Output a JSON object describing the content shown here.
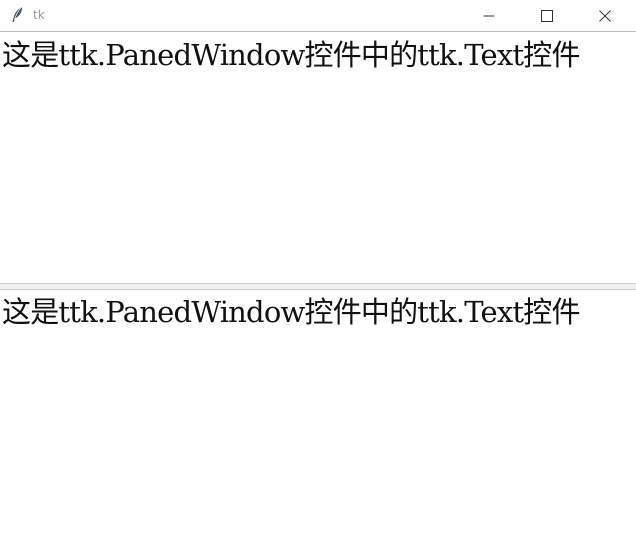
{
  "window": {
    "title": "tk",
    "icons": {
      "app": "tk-feather-icon",
      "minimize": "minimize-icon",
      "maximize": "maximize-icon",
      "close": "close-icon"
    }
  },
  "panes": [
    {
      "text": "这是ttk.PanedWindow控件中的ttk.Text控件"
    },
    {
      "text": "这是ttk.PanedWindow控件中的ttk.Text控件"
    }
  ],
  "colors": {
    "title_text": "#9a9a9a",
    "text": "#111111",
    "sash": "#f0f0f0"
  }
}
